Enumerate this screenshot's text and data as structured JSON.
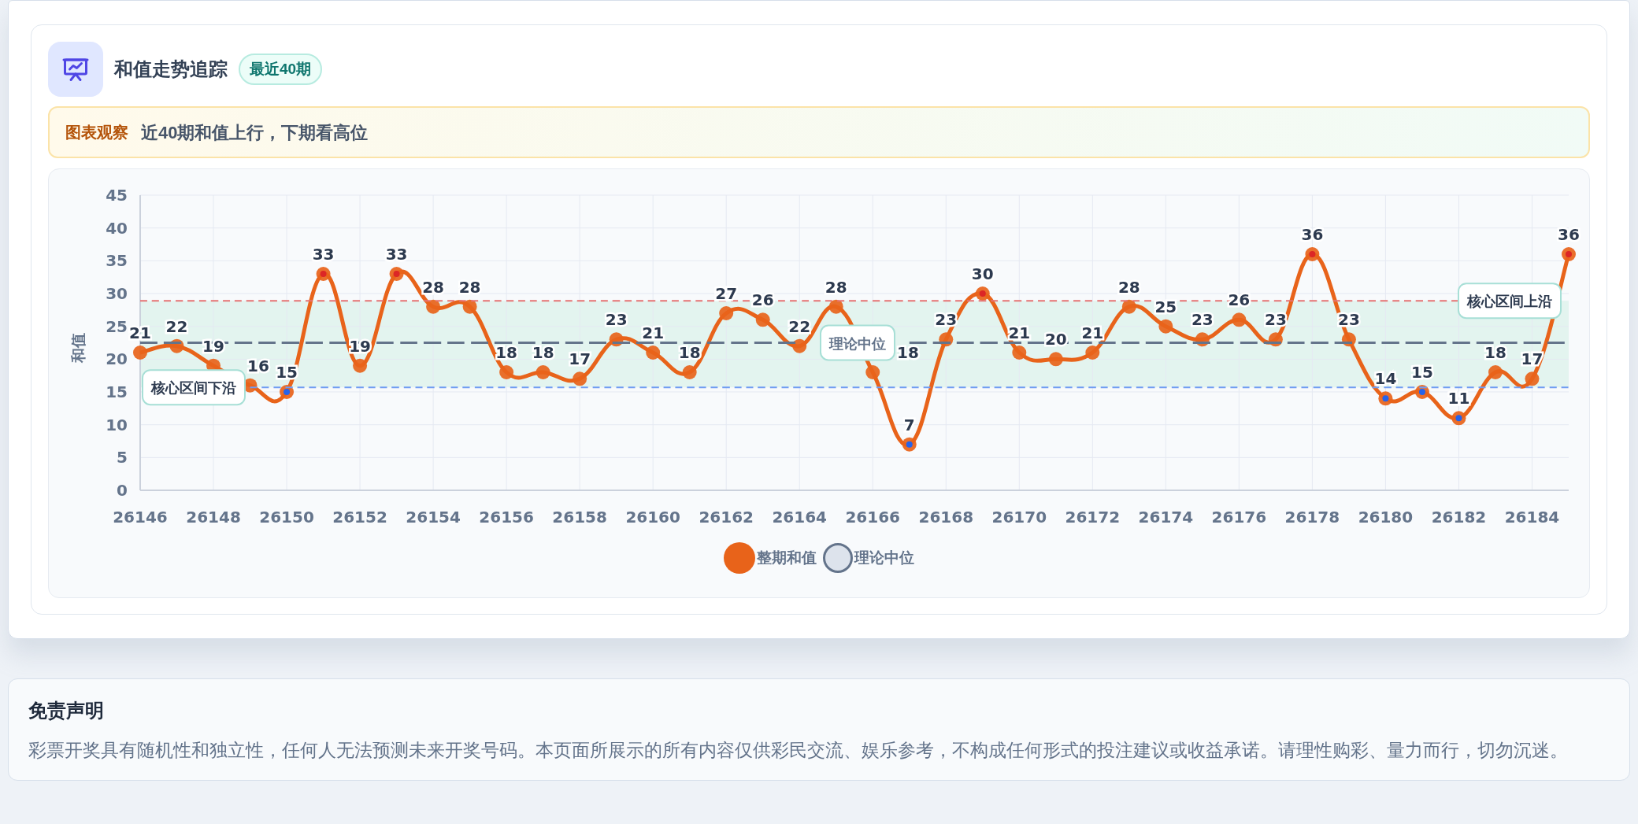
{
  "header": {
    "title": "和值走势追踪",
    "badge": "最近40期"
  },
  "insight": {
    "tag": "图表观察",
    "text": "近40期和值上行，下期看高位"
  },
  "chart": {
    "chart_data": {
      "type": "line",
      "ylabel": "和值",
      "x": [
        26146,
        26147,
        26148,
        26149,
        26150,
        26151,
        26152,
        26153,
        26154,
        26155,
        26156,
        26157,
        26158,
        26159,
        26160,
        26161,
        26162,
        26163,
        26164,
        26165,
        26166,
        26167,
        26168,
        26169,
        26170,
        26171,
        26172,
        26173,
        26174,
        26175,
        26176,
        26177,
        26178,
        26179,
        26180,
        26181,
        26182,
        26183,
        26184,
        26185
      ],
      "series": [
        {
          "name": "整期和值",
          "color": "#e8631a",
          "marker": "circle",
          "values": [
            21,
            22,
            19,
            16,
            15,
            33,
            19,
            33,
            28,
            28,
            18,
            18,
            17,
            23,
            21,
            18,
            27,
            26,
            22,
            28,
            18,
            7,
            23,
            30,
            21,
            20,
            21,
            28,
            25,
            23,
            26,
            23,
            36,
            23,
            14,
            15,
            11,
            18,
            17,
            36
          ]
        },
        {
          "name": "理论中位",
          "color": "#64748b",
          "line_style": "dashed",
          "values": [
            22.5,
            22.5,
            22.5,
            22.5,
            22.5,
            22.5,
            22.5,
            22.5,
            22.5,
            22.5,
            22.5,
            22.5,
            22.5,
            22.5,
            22.5,
            22.5,
            22.5,
            22.5,
            22.5,
            null,
            null,
            22.5,
            22.5,
            22.5,
            22.5,
            22.5,
            22.5,
            22.5,
            22.5,
            22.5,
            22.5,
            22.5,
            22.5,
            22.5,
            22.5,
            22.5,
            22.5,
            22.5,
            22.5,
            22.5
          ]
        },
        {
          "name": "核心区间上沿",
          "color": "#e57373",
          "line_style": "dashed",
          "values": [
            28.9,
            28.9,
            28.9,
            28.9,
            28.9,
            28.9,
            28.9,
            28.9,
            28.9,
            28.9,
            28.9,
            28.9,
            28.9,
            28.9,
            28.9,
            28.9,
            28.9,
            28.9,
            28.9,
            28.9,
            28.9,
            28.9,
            28.9,
            28.9,
            28.9,
            28.9,
            28.9,
            28.9,
            28.9,
            28.9,
            28.9,
            28.9,
            28.9,
            28.9,
            28.9,
            28.9,
            28.9,
            null,
            null,
            null
          ]
        },
        {
          "name": "核心区间下沿",
          "color": "#6f9cf2",
          "line_style": "dashed",
          "values": [
            null,
            null,
            null,
            15.7,
            15.7,
            15.7,
            15.7,
            15.7,
            15.7,
            15.7,
            15.7,
            15.7,
            15.7,
            15.7,
            15.7,
            15.7,
            15.7,
            15.7,
            15.7,
            15.7,
            15.7,
            15.7,
            15.7,
            15.7,
            15.7,
            15.7,
            15.7,
            15.7,
            15.7,
            15.7,
            15.7,
            15.7,
            15.7,
            15.7,
            15.7,
            15.7,
            15.7,
            15.7,
            15.7,
            15.7
          ]
        }
      ],
      "xlim": [
        26146,
        26185
      ],
      "ylim": [
        0,
        45
      ],
      "yticks": [
        0,
        5,
        10,
        15,
        20,
        25,
        30,
        35,
        40,
        45
      ],
      "xticks": [
        26146,
        26148,
        26150,
        26152,
        26154,
        26156,
        26158,
        26160,
        26162,
        26164,
        26166,
        26168,
        26170,
        26172,
        26174,
        26176,
        26178,
        26180,
        26182,
        26184
      ],
      "grid": true,
      "value_labels": [
        [
          "21",
          "22",
          "19",
          "16",
          "15",
          "33",
          "19",
          "33",
          "28",
          "28",
          "18",
          "18",
          "17",
          "23",
          "21",
          "18",
          "27",
          "26",
          "22",
          "28",
          "18",
          "7",
          "23",
          "30",
          "21",
          "20",
          "21",
          "28",
          "25",
          "23",
          "26",
          "23",
          "36",
          "23",
          "14",
          "15",
          "11",
          "18",
          "17",
          "36"
        ],
        null,
        null,
        null
      ]
    }
  },
  "disclaimer": {
    "title": "免责声明",
    "text": "彩票开奖具有随机性和独立性，任何人无法预测未来开奖号码。本页面所展示的所有内容仅供彩民交流、娱乐参考，不构成任何形式的投注建议或收益承诺。请理性购彩、量力而行，切勿沉迷。"
  }
}
